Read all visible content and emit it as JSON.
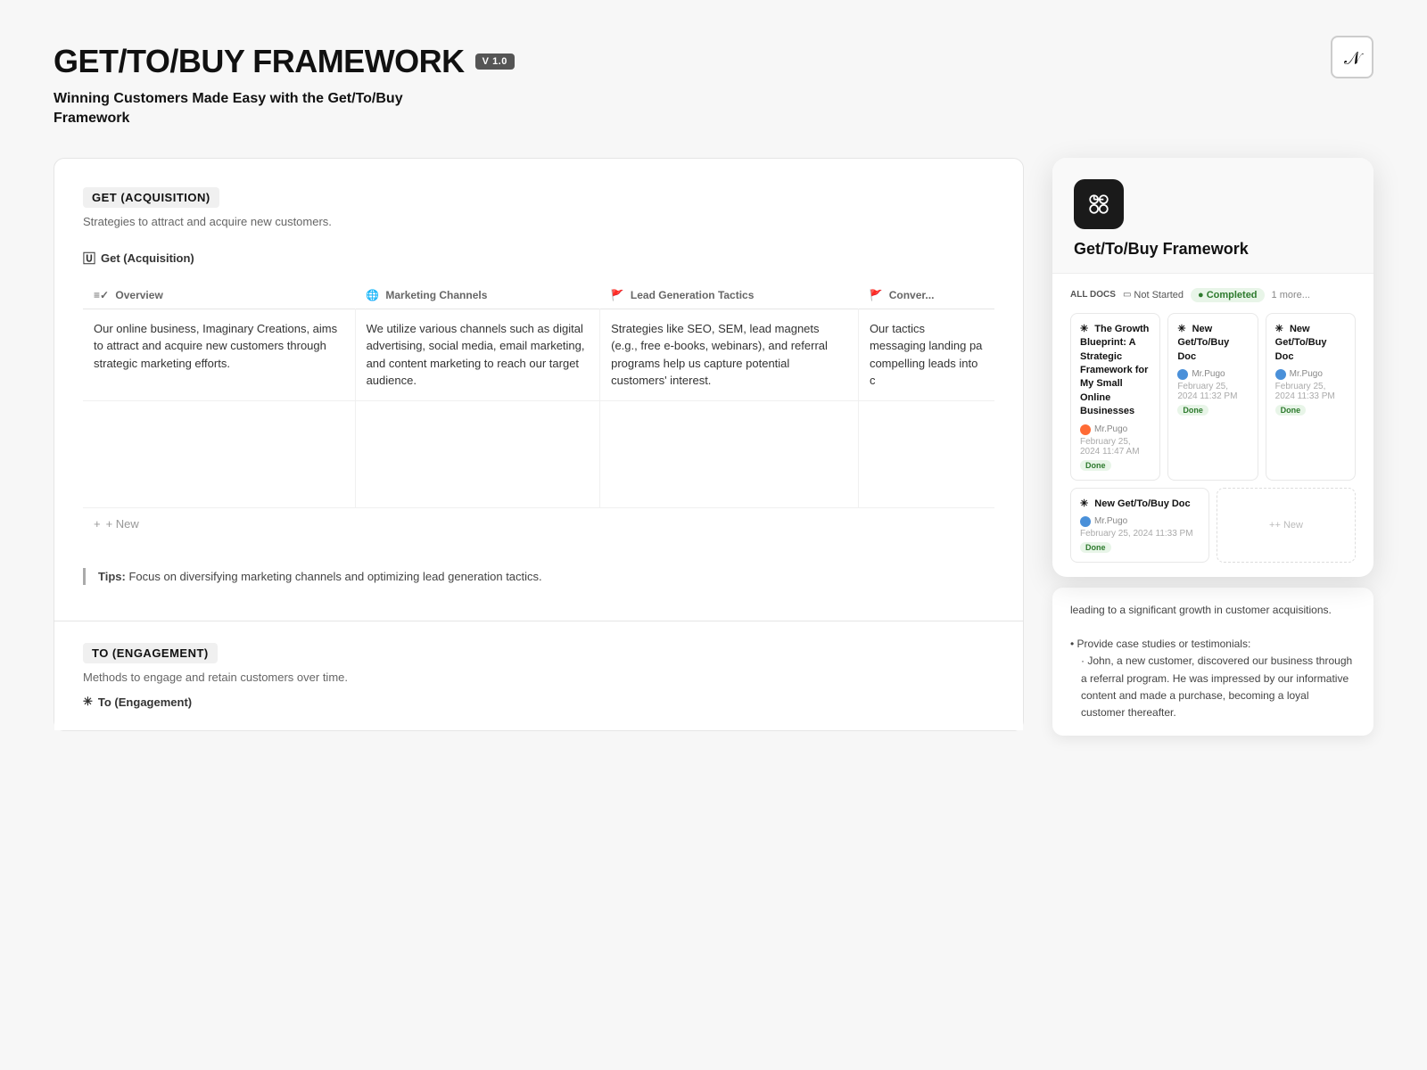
{
  "header": {
    "title": "GET/TO/BUY FRAMEWORK",
    "version": "V 1.0",
    "subtitle": "Winning Customers Made Easy with the Get/To/Buy Framework"
  },
  "get_section": {
    "tag": "GET (ACQUISITION)",
    "description": "Strategies to attract and acquire new customers.",
    "view_label": "Get (Acquisition)",
    "view_icon": "🅄",
    "columns": [
      {
        "icon": "≡✓",
        "label": "Overview"
      },
      {
        "icon": "🌐",
        "label": "Marketing Channels"
      },
      {
        "icon": "🚩",
        "label": "Lead Generation Tactics"
      },
      {
        "icon": "🚩",
        "label": "Conver..."
      }
    ],
    "rows": [
      {
        "overview": "Our online business, Imaginary Creations, aims to attract and acquire new customers through strategic marketing efforts.",
        "marketing_channels": "We utilize various channels such as digital advertising, social media, email marketing, and content marketing to reach our target audience.",
        "lead_generation": "Strategies like SEO, SEM, lead magnets (e.g., free e-books, webinars), and referral programs help us capture potential customers' interest.",
        "conversion": "Our tactics messaging landing pa compelling leads into c"
      }
    ],
    "new_row_label": "+ New"
  },
  "tips": {
    "label": "Tips:",
    "text": "Focus on diversifying marketing channels and optimizing lead generation tactics."
  },
  "to_section": {
    "tag": "TO (ENGAGEMENT)",
    "description": "Methods to engage and retain customers over time.",
    "view_label": "To (Engagement)",
    "view_icon": "✳"
  },
  "framework_card": {
    "app_icon_alt": "Get/To/Buy app icon",
    "title": "Get/To/Buy Framework",
    "filters": {
      "all_docs": "ALL DOCS",
      "not_started": "Not Started",
      "completed": "Completed",
      "more": "1 more..."
    },
    "docs": [
      {
        "title": "The Growth Blueprint: A Strategic Framework for My Small Online Businesses",
        "author": "Mr.Pugo",
        "date": "February 25, 2024 11:47 AM",
        "status": "Done",
        "avatar_color": "orange"
      },
      {
        "title": "New Get/To/Buy Doc",
        "author": "Mr.Pugo",
        "date": "February 25, 2024 11:32 PM",
        "status": "Done",
        "avatar_color": "blue"
      },
      {
        "title": "New Get/To/Buy Doc",
        "author": "Mr.Pugo",
        "date": "February 25, 2024 11:33 PM",
        "status": "Done",
        "avatar_color": "blue"
      },
      {
        "title": "New Get/To/Buy Doc",
        "author": "Mr.Pugo",
        "date": "February 25, 2024 11:33 PM",
        "status": "Done",
        "avatar_color": "blue"
      }
    ],
    "new_button": "+ New"
  },
  "text_card": {
    "content1": "leading to a significant growth in customer acquisitions.",
    "content2": "• Provide case studies or testimonials:",
    "content3": "· John, a new customer, discovered our business through a referral program. He was impressed by our informative content and made a purchase, becoming a loyal customer thereafter."
  }
}
